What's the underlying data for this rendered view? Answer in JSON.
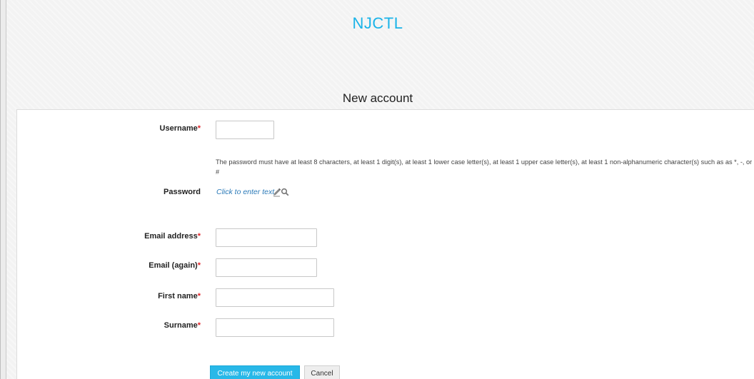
{
  "header": {
    "brand": "NJCTL",
    "title": "New account"
  },
  "form": {
    "username": {
      "label": "Username",
      "required_mark": "*"
    },
    "password": {
      "help_text": "The password must have at least 8 characters, at least 1 digit(s), at least 1 lower case letter(s), at least 1 upper case letter(s), at least 1 non-alphanumeric character(s) such as as *, -, or #",
      "label": "Password",
      "link_text": "Click to enter text",
      "icons": [
        "pencil-icon",
        "search-icon"
      ]
    },
    "email": {
      "label": "Email address",
      "required_mark": "*"
    },
    "email_again": {
      "label": "Email (again)",
      "required_mark": "*"
    },
    "first_name": {
      "label": "First name",
      "required_mark": "*"
    },
    "surname": {
      "label": "Surname",
      "required_mark": "*"
    }
  },
  "actions": {
    "create": "Create my new account",
    "cancel": "Cancel"
  },
  "colors": {
    "brand": "#1ab3e8",
    "required": "#e0262b",
    "link": "#2b7ab8",
    "primary_button": "#28b8e8"
  }
}
